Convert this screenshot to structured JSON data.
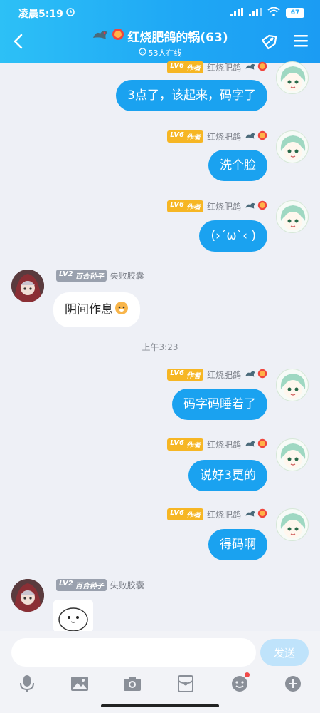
{
  "status": {
    "time": "凌晨5:19",
    "battery": "67"
  },
  "header": {
    "title": "红烧肥鸽的锅(63)",
    "online": "53人在线"
  },
  "time_divider": "上午3:23",
  "badges": {
    "author_level": "LV6",
    "author_role": "作者",
    "member_level": "LV2",
    "member_role": "百合种子"
  },
  "senders": {
    "me": "红烧肥鸽",
    "other": "失败胶囊"
  },
  "messages": [
    {
      "text": "3点了，该起来，码字了"
    },
    {
      "text": "洗个脸"
    },
    {
      "text": "(›´ω`‹ )"
    },
    {
      "text": "阴间作息"
    },
    {
      "text": "码字码睡着了"
    },
    {
      "text": "说好3更的"
    },
    {
      "text": "得码啊"
    }
  ],
  "input": {
    "placeholder": "",
    "value": "",
    "send_label": "发送"
  },
  "colors": {
    "header": "#1fa8f5",
    "bubble_me": "#1aa2f0",
    "badge_author": "#f6b624",
    "badge_member": "#9aa1ae"
  },
  "icons": [
    "mic-icon",
    "image-icon",
    "camera-icon",
    "red-packet-icon",
    "emoji-icon",
    "plus-icon"
  ]
}
